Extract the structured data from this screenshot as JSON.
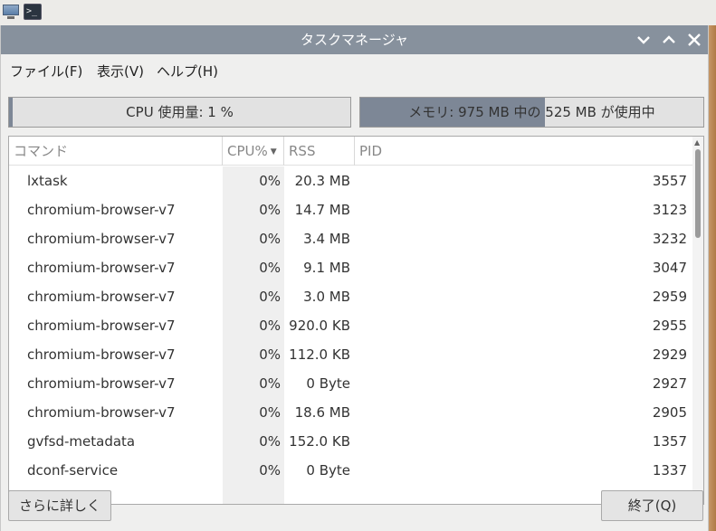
{
  "window": {
    "title": "タスクマネージャ"
  },
  "menu": {
    "file": "ファイル(F)",
    "view": "表示(V)",
    "help": "ヘルプ(H)"
  },
  "meters": {
    "cpu_label": "CPU 使用量: 1 %",
    "cpu_fraction": 0.01,
    "mem_label": "メモリ: 975 MB 中の 525 MB が使用中",
    "mem_fraction": 0.538
  },
  "table": {
    "headers": {
      "command": "コマンド",
      "cpu": "CPU%",
      "rss": "RSS",
      "pid": "PID"
    },
    "rows": [
      {
        "command": "lxtask",
        "cpu": "0%",
        "rss": "20.3 MB",
        "pid": "3557"
      },
      {
        "command": "chromium-browser-v7",
        "cpu": "0%",
        "rss": "14.7 MB",
        "pid": "3123"
      },
      {
        "command": "chromium-browser-v7",
        "cpu": "0%",
        "rss": "3.4 MB",
        "pid": "3232"
      },
      {
        "command": "chromium-browser-v7",
        "cpu": "0%",
        "rss": "9.1 MB",
        "pid": "3047"
      },
      {
        "command": "chromium-browser-v7",
        "cpu": "0%",
        "rss": "3.0 MB",
        "pid": "2959"
      },
      {
        "command": "chromium-browser-v7",
        "cpu": "0%",
        "rss": "920.0 KB",
        "pid": "2955"
      },
      {
        "command": "chromium-browser-v7",
        "cpu": "0%",
        "rss": "112.0 KB",
        "pid": "2929"
      },
      {
        "command": "chromium-browser-v7",
        "cpu": "0%",
        "rss": "0 Byte",
        "pid": "2927"
      },
      {
        "command": "chromium-browser-v7",
        "cpu": "0%",
        "rss": "18.6 MB",
        "pid": "2905"
      },
      {
        "command": "gvfsd-metadata",
        "cpu": "0%",
        "rss": "152.0 KB",
        "pid": "1357"
      },
      {
        "command": "dconf-service",
        "cpu": "0%",
        "rss": "0 Byte",
        "pid": "1337"
      }
    ]
  },
  "buttons": {
    "more": "さらに詳しく",
    "quit": "終了(Q)"
  },
  "icons": {
    "taskbar": [
      "monitor-icon",
      "terminal-icon"
    ],
    "terminal_glyph": ">_",
    "minimize": "chevron-down-icon",
    "maximize": "chevron-up-icon",
    "close": "close-icon"
  }
}
